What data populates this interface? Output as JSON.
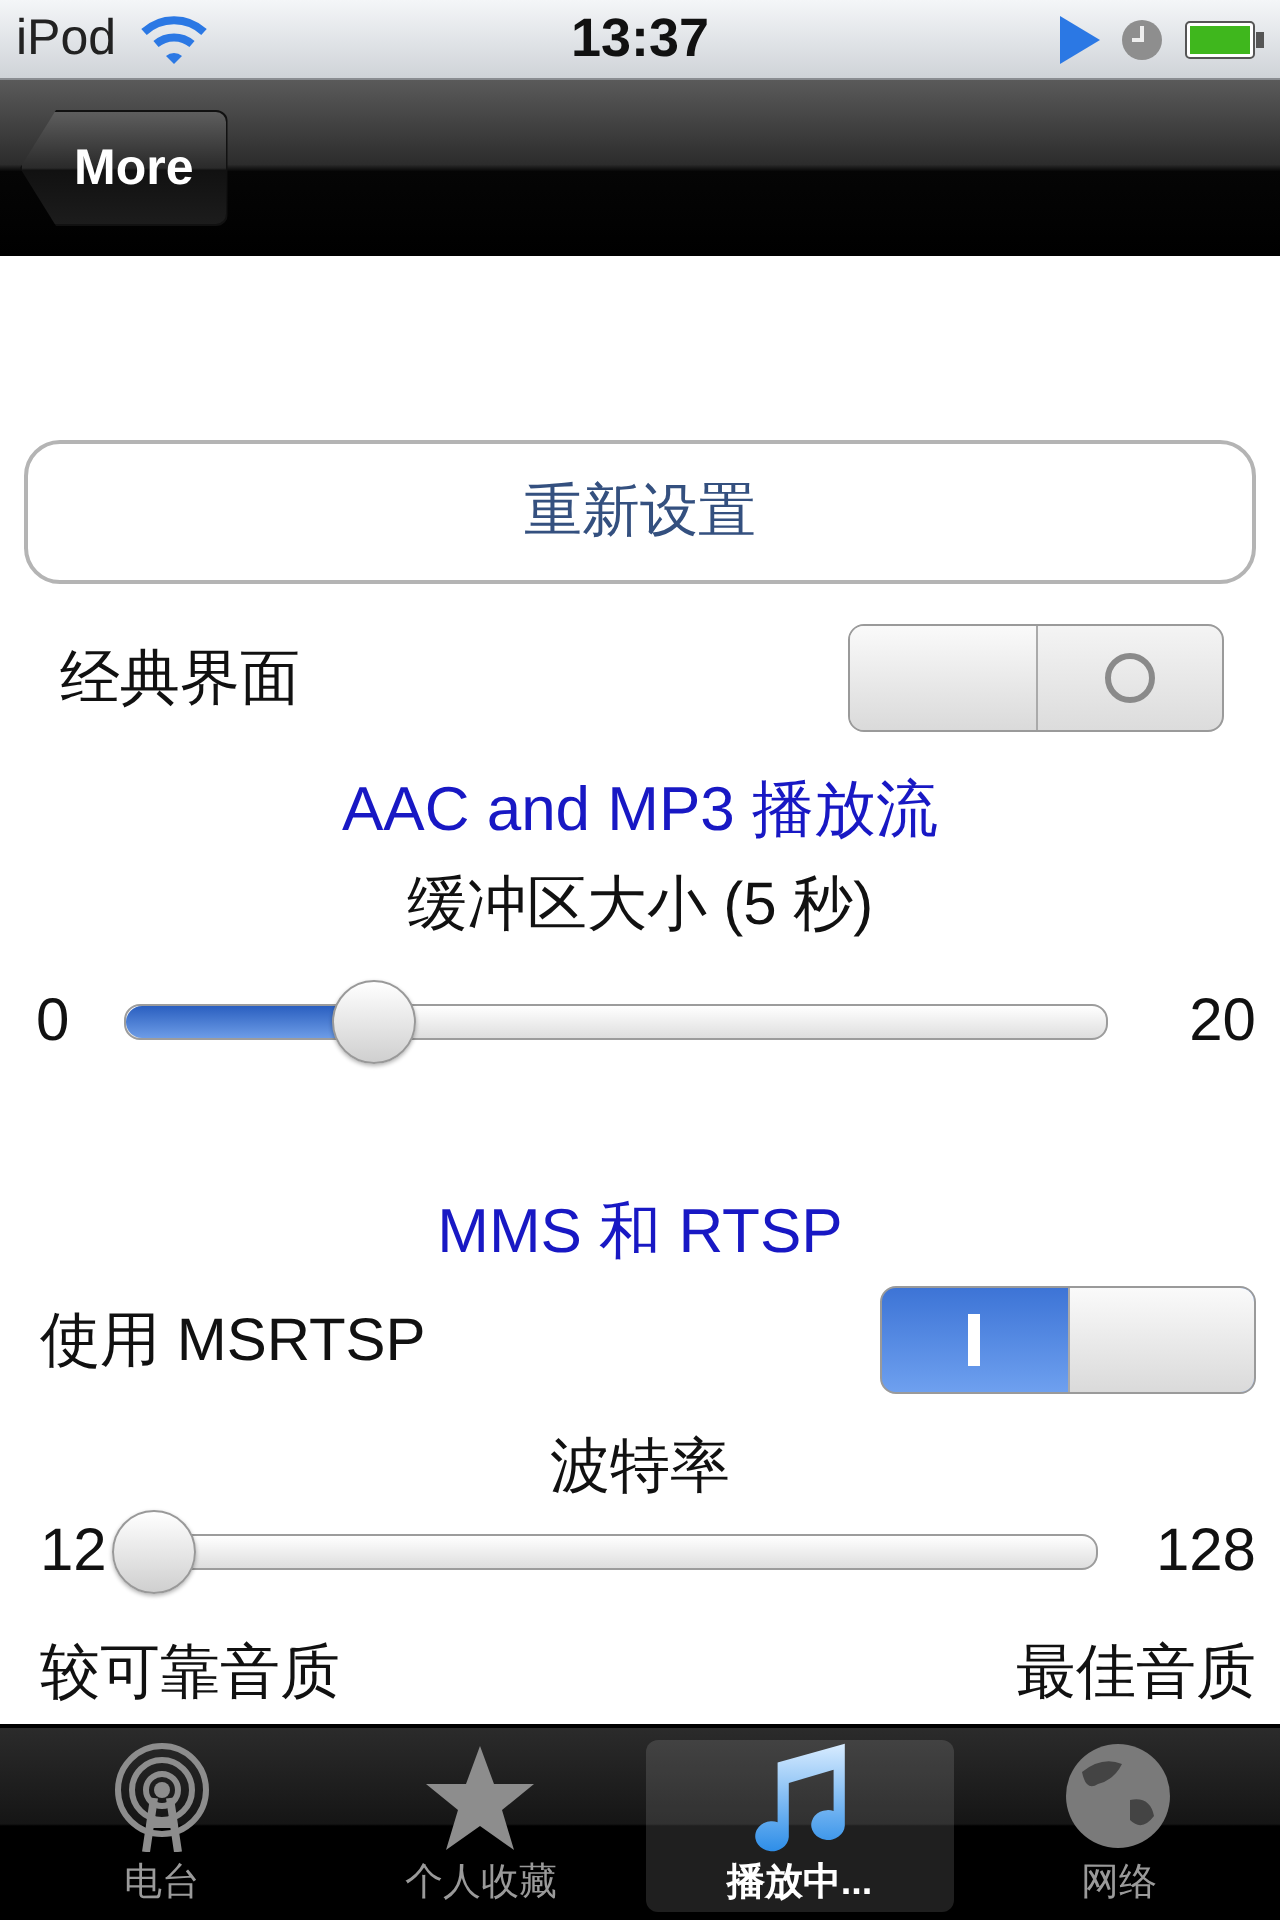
{
  "status_bar": {
    "carrier": "iPod",
    "time": "13:37"
  },
  "nav_bar": {
    "back_button": "More"
  },
  "reset_button": "重新设置",
  "classic_ui": {
    "label": "经典界面",
    "on": false
  },
  "stream_section": {
    "title": "AAC and MP3 播放流",
    "slider_label": "缓冲区大小 (5 秒)",
    "min": "0",
    "max": "20",
    "level": 0.25
  },
  "mms_section": {
    "title": "MMS 和 RTSP",
    "switch_label": "使用 MSRTSP",
    "on": true,
    "slider_label": "波特率",
    "min": "12",
    "max": "128",
    "level": 0,
    "low_label": "较可靠音质",
    "high_label": "最佳音质"
  },
  "tab_bar": [
    {
      "kind": "radio",
      "label": "电台",
      "selected": false
    },
    {
      "kind": "favorites",
      "label": "个人收藏",
      "selected": false
    },
    {
      "kind": "playing",
      "label": "播放中...",
      "selected": true
    },
    {
      "kind": "network",
      "label": "网络",
      "selected": false
    }
  ]
}
